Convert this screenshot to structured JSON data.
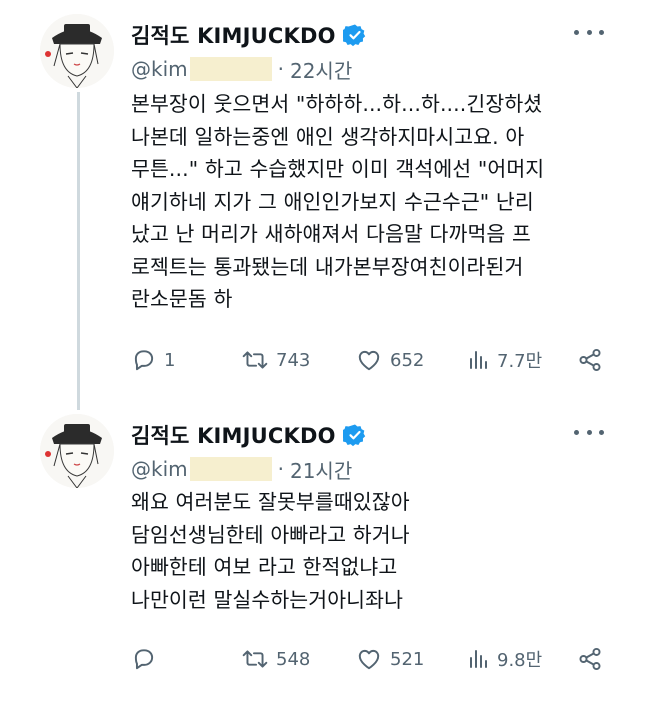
{
  "tweets": [
    {
      "display_name": "김적도 KIMJUCKDO",
      "handle": "@kim",
      "separator": "·",
      "time": "22시간",
      "text": "본부장이 웃으면서 \"하하하...하...하....긴장하셨\n나본데 일하는중엔 애인 생각하지마시고요. 아\n무튼...\" 하고 수습했지만 이미 객석에선 \"어머지\n얘기하네 지가 그 애인인가보지 수근수근\" 난리\n났고 난 머리가 새하얘져서 다음말 다까먹음 프\n로젝트는 통과됐는데 내가본부장여친이라된거\n란소문돔 하",
      "reply_count": "1",
      "retweet_count": "743",
      "like_count": "652",
      "view_count": "7.7만"
    },
    {
      "display_name": "김적도 KIMJUCKDO",
      "handle": "@kim",
      "separator": "·",
      "time": "21시간",
      "text": "왜요 여러분도 잘못부를때있잖아\n담임선생님한테 아빠라고 하거나\n아빠한테 여보 라고 한적없냐고\n나만이런 말실수하는거아니좌나",
      "reply_count": "",
      "retweet_count": "548",
      "like_count": "521",
      "view_count": "9.8만"
    }
  ],
  "icons": {
    "verified": "verified-badge-icon",
    "more": "more-options-icon",
    "reply": "reply-icon",
    "retweet": "retweet-icon",
    "like": "heart-icon",
    "views": "views-chart-icon",
    "share": "share-icon"
  },
  "colors": {
    "verified": "#1d9bf0",
    "text": "#0f1419",
    "secondary": "#536471",
    "thread_line": "#cfd9de",
    "redaction": "#f6efcf"
  }
}
